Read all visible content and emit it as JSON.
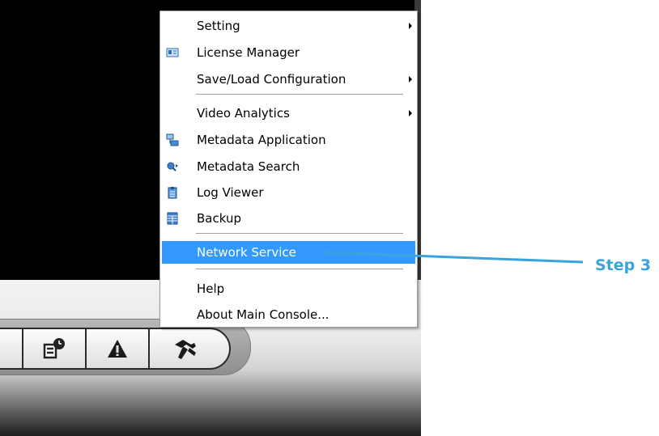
{
  "menu": {
    "items": [
      {
        "label": "Setting",
        "icon": "none",
        "submenu": true
      },
      {
        "label": "License Manager",
        "icon": "license-card-icon",
        "submenu": false
      },
      {
        "label": "Save/Load Configuration",
        "icon": "none",
        "submenu": true
      },
      {
        "label": "Video Analytics",
        "icon": "none",
        "submenu": true
      },
      {
        "label": "Metadata Application",
        "icon": "metadata-application-icon",
        "submenu": false
      },
      {
        "label": "Metadata Search",
        "icon": "magnifier-search-icon",
        "submenu": false
      },
      {
        "label": "Log Viewer",
        "icon": "clipboard-log-icon",
        "submenu": false
      },
      {
        "label": "Backup",
        "icon": "backup-grid-icon",
        "submenu": false
      },
      {
        "label": "Network Service",
        "icon": "none",
        "submenu": false,
        "highlighted": true
      },
      {
        "label": "Help",
        "icon": "none",
        "submenu": false
      },
      {
        "label": "About Main Console...",
        "icon": "none",
        "submenu": false
      }
    ],
    "highlight_color": "#3399ff"
  },
  "toolbar": {
    "buttons": [
      {
        "icon": "partial-button-icon"
      },
      {
        "icon": "schedule-report-icon"
      },
      {
        "icon": "alert-warning-icon"
      },
      {
        "icon": "hammer-tools-icon"
      }
    ]
  },
  "callout": {
    "label": "Step 3",
    "color": "#3aa3dc"
  }
}
